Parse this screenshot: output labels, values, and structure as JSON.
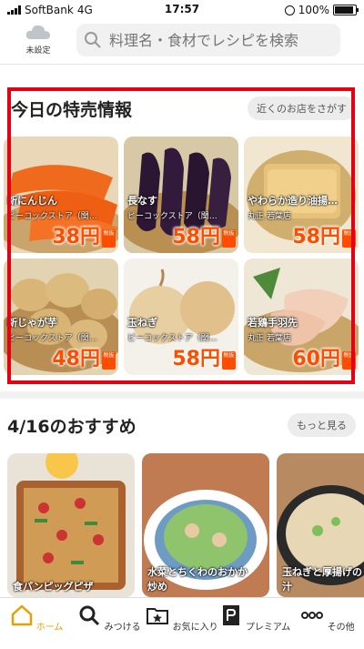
{
  "status_bar": {
    "carrier": "SoftBank",
    "network": "4G",
    "time": "17:57",
    "battery": "100%"
  },
  "header": {
    "location_label": "未設定",
    "search_placeholder": "料理名・食材でレシピを検索"
  },
  "sale_section": {
    "title": "今日の特売情報",
    "store_button": "近くのお店をさがす",
    "items": [
      {
        "name": "新にんじん",
        "store": "ピーコックストア（関…",
        "price": "38円"
      },
      {
        "name": "長なす",
        "store": "ピーコックストア（関…",
        "price": "58円"
      },
      {
        "name": "やわらか造り油揚…",
        "store": "丸正 若葉店",
        "price": "58円"
      },
      {
        "name": "新じゃが芋",
        "store": "ピーコックストア（関…",
        "price": "48円"
      },
      {
        "name": "玉ねぎ",
        "store": "ピーコックストア（関…",
        "price": "58円"
      },
      {
        "name": "若鶏手羽先",
        "store": "丸正 若葉店",
        "price": "60円"
      }
    ],
    "tax_badge": "税抜"
  },
  "recommend_section": {
    "title": "4/16のおすすめ",
    "more_button": "もっと見る",
    "items": [
      {
        "line1": "食パンピッグピザ",
        "line2": ""
      },
      {
        "line1": "水菜とちくわのおかか",
        "line2": "炒め"
      },
      {
        "line1": "玉ねぎと厚揚げの",
        "line2": "汁"
      }
    ]
  },
  "tab_bar": {
    "items": [
      {
        "label": "ホーム",
        "icon": "home-icon"
      },
      {
        "label": "みつける",
        "icon": "search-icon"
      },
      {
        "label": "お気に入り",
        "icon": "favorite-folder-icon"
      },
      {
        "label": "プレミアム",
        "icon": "premium-icon"
      },
      {
        "label": "その他",
        "icon": "more-icon"
      }
    ]
  },
  "colors": {
    "accent": "#e8a000",
    "highlight_border": "#e60012",
    "price": "#ff4d00"
  }
}
